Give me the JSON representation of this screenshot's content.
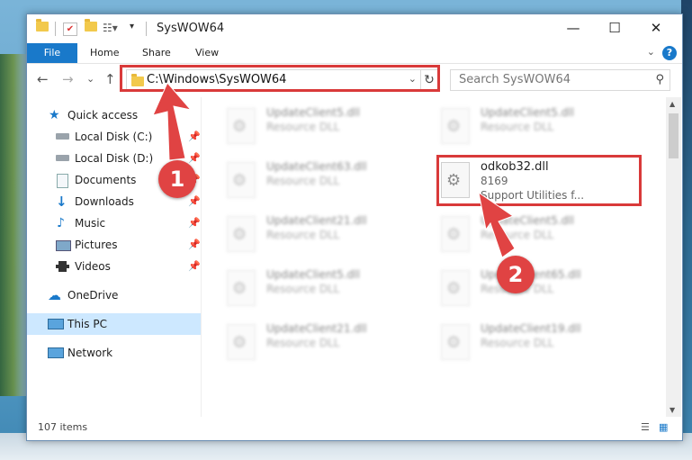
{
  "window": {
    "title": "SysWOW64",
    "controls": {
      "minimize": "—",
      "maximize": "☐",
      "close": "✕"
    }
  },
  "ribbon": {
    "tabs": [
      "File",
      "Home",
      "Share",
      "View"
    ],
    "help": "?",
    "expand": "⌄"
  },
  "navigation": {
    "back": "←",
    "forward": "→",
    "recent": "⌄",
    "up": "↑"
  },
  "address": {
    "path": "C:\\Windows\\SysWOW64",
    "chevron": "⌄",
    "refresh": "↻"
  },
  "search": {
    "placeholder": "Search SysWOW64",
    "icon": "search-icon"
  },
  "sidebar": {
    "items": [
      {
        "label": "Quick access",
        "icon": "star-icon",
        "pinned": false
      },
      {
        "label": "Local Disk (C:)",
        "icon": "drive-icon",
        "pinned": true
      },
      {
        "label": "Local Disk (D:)",
        "icon": "drive-icon",
        "pinned": true
      },
      {
        "label": "Documents",
        "icon": "documents-icon",
        "pinned": true
      },
      {
        "label": "Downloads",
        "icon": "download-icon",
        "pinned": true
      },
      {
        "label": "Music",
        "icon": "music-icon",
        "pinned": true
      },
      {
        "label": "Pictures",
        "icon": "pictures-icon",
        "pinned": true
      },
      {
        "label": "Videos",
        "icon": "videos-icon",
        "pinned": true
      },
      {
        "label": "OneDrive",
        "icon": "cloud-icon",
        "pinned": false
      },
      {
        "label": "This PC",
        "icon": "computer-icon",
        "pinned": false,
        "selected": true
      },
      {
        "label": "Network",
        "icon": "network-icon",
        "pinned": false
      }
    ]
  },
  "files": {
    "left": [
      {
        "name": "UpdateClient5.dll",
        "type": "Resource DLL"
      },
      {
        "name": "UpdateClient63.dll",
        "type": "Resource DLL"
      },
      {
        "name": "UpdateClient21.dll",
        "type": "Resource DLL"
      },
      {
        "name": "UpdateClient5.dll",
        "type": "Resource DLL"
      },
      {
        "name": "UpdateClient21.dll",
        "type": "Resource DLL"
      }
    ],
    "right": [
      {
        "name": "UpdateClient5.dll",
        "type": "Resource DLL"
      },
      {
        "name": "UpdateClient5.dll",
        "type": "Resource DLL"
      },
      {
        "name": "UpdateClient65.dll",
        "type": "Resource DLL"
      },
      {
        "name": "UpdateClient19.dll",
        "type": "Resource DLL"
      }
    ],
    "featured": {
      "name": "odkob32.dll",
      "size": "8169",
      "description": "Support Utilities f..."
    }
  },
  "status": {
    "item_count": "107 items"
  },
  "callouts": {
    "one": "1",
    "two": "2"
  },
  "colors": {
    "accent": "#1979ca",
    "highlight": "#d93a3a",
    "selected": "#cde8ff"
  }
}
